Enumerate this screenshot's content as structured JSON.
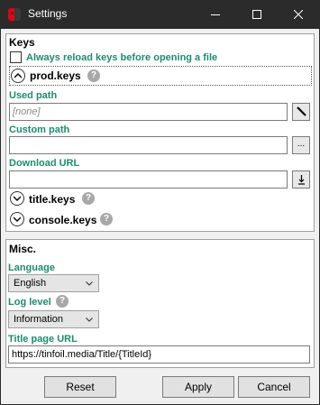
{
  "window": {
    "title": "Settings",
    "app_icon": "nintendo-switch-icon",
    "controls": [
      "minimize-icon",
      "maximize-icon",
      "close-icon"
    ]
  },
  "keys": {
    "group_title": "Keys",
    "reload_checkbox": {
      "label": "Always reload keys before opening a file",
      "checked": false
    },
    "prod_keys": {
      "label": "prod.keys",
      "expanded": true,
      "help": "?",
      "used_path_label": "Used path",
      "used_path_value": "[none]",
      "edit_icon": "pencil-icon",
      "custom_path_label": "Custom path",
      "custom_path_value": "",
      "browse_label": "...",
      "download_url_label": "Download URL",
      "download_url_value": "",
      "download_icon": "download-icon"
    },
    "title_keys": {
      "label": "title.keys",
      "expanded": false,
      "help": "?"
    },
    "console_keys": {
      "label": "console.keys",
      "expanded": false,
      "help": "?"
    }
  },
  "misc": {
    "group_title": "Misc.",
    "language_label": "Language",
    "language_value": "English",
    "log_level_label": "Log level",
    "log_level_help": "?",
    "log_level_value": "Information",
    "title_page_url_label": "Title page URL",
    "title_page_url_value": "https://tinfoil.media/Title/{TitleId}"
  },
  "footer": {
    "reset_label": "Reset",
    "apply_label": "Apply",
    "cancel_label": "Cancel"
  },
  "colors": {
    "titlebar_bg": "#2b2b2b",
    "label_green": "#1f8a70",
    "panel_bg": "#f0f0f0"
  }
}
